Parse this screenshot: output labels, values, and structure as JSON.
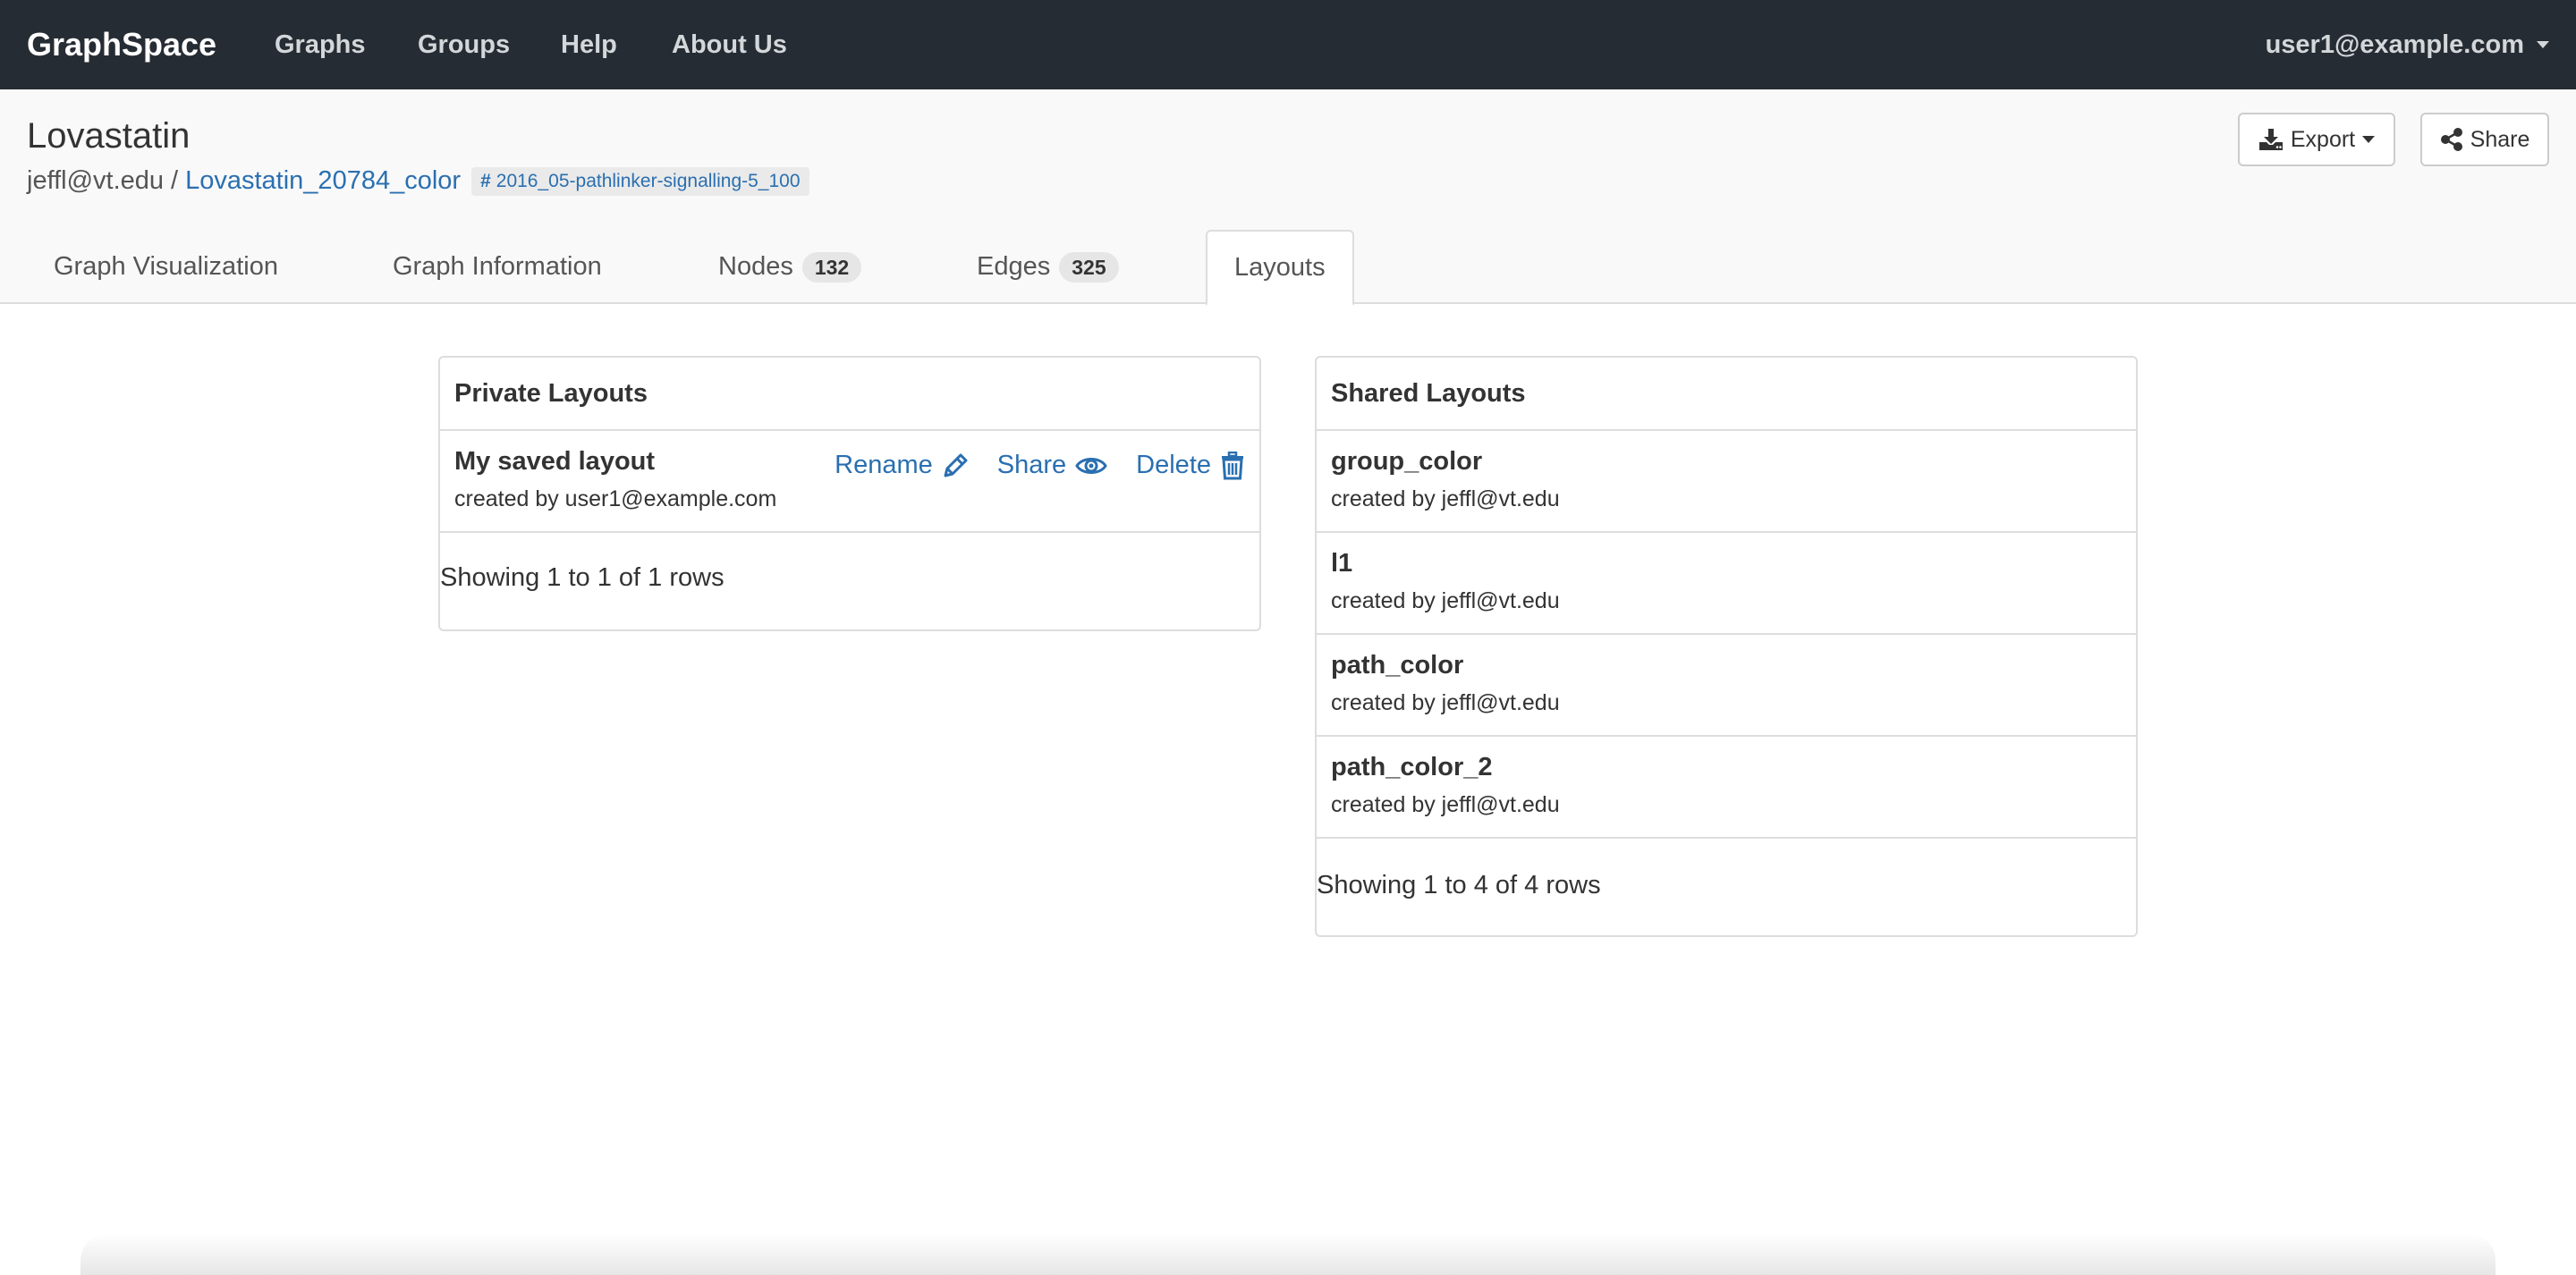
{
  "navbar": {
    "brand": "GraphSpace",
    "links": [
      "Graphs",
      "Groups",
      "Help",
      "About Us"
    ],
    "user": "user1@example.com"
  },
  "header": {
    "title": "Lovastatin",
    "owner": "jeffl@vt.edu",
    "separator": "/",
    "graph_name": "Lovastatin_20784_color",
    "tag": "2016_05-pathlinker-signalling-5_100",
    "export_label": "Export",
    "share_label": "Share"
  },
  "tabs": [
    {
      "label": "Graph Visualization",
      "count": null,
      "active": false
    },
    {
      "label": "Graph Information",
      "count": null,
      "active": false
    },
    {
      "label": "Nodes",
      "count": "132",
      "active": false
    },
    {
      "label": "Edges",
      "count": "325",
      "active": false
    },
    {
      "label": "Layouts",
      "count": null,
      "active": true
    }
  ],
  "private_layouts": {
    "heading": "Private Layouts",
    "rows": [
      {
        "name": "My saved layout",
        "created_by": "created by user1@example.com"
      }
    ],
    "actions": {
      "rename": "Rename",
      "share": "Share",
      "delete": "Delete"
    },
    "footer": "Showing 1 to 1 of 1 rows"
  },
  "shared_layouts": {
    "heading": "Shared Layouts",
    "rows": [
      {
        "name": "group_color",
        "created_by": "created by jeffl@vt.edu"
      },
      {
        "name": "l1",
        "created_by": "created by jeffl@vt.edu"
      },
      {
        "name": "path_color",
        "created_by": "created by jeffl@vt.edu"
      },
      {
        "name": "path_color_2",
        "created_by": "created by jeffl@vt.edu"
      }
    ],
    "footer": "Showing 1 to 4 of 4 rows"
  },
  "colors": {
    "navbar_bg": "#262c33",
    "link_blue": "#2a6fb0",
    "header_bg": "#f9f9f9"
  }
}
